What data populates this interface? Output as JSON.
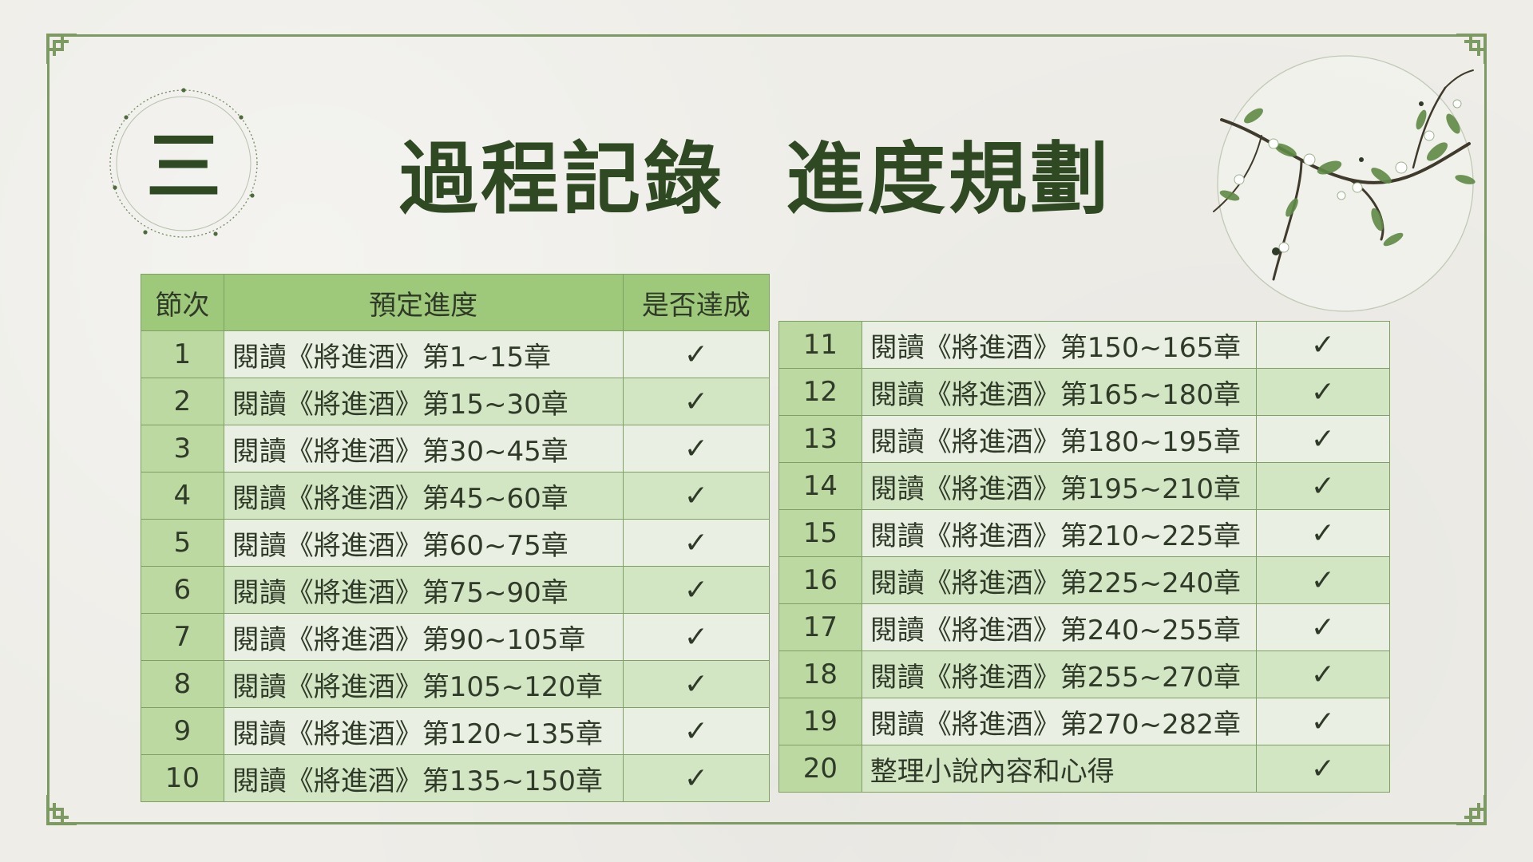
{
  "section_number": "三",
  "title": "過程記錄  進度規劃",
  "colors": {
    "frame": "#7d9a62",
    "title_text": "#2f4a22",
    "header_bg": "#9fc97a",
    "number_column_bg": "#bcd9a2",
    "row_light": "#e9efe3",
    "row_green": "#d3e6c4"
  },
  "table": {
    "headers": {
      "session": "節次",
      "plan": "預定進度",
      "done": "是否達成"
    },
    "left_rows": [
      {
        "num": "1",
        "task": "閱讀《將進酒》第1~15章",
        "done": "✓"
      },
      {
        "num": "2",
        "task": "閱讀《將進酒》第15~30章",
        "done": "✓"
      },
      {
        "num": "3",
        "task": "閱讀《將進酒》第30~45章",
        "done": "✓"
      },
      {
        "num": "4",
        "task": "閱讀《將進酒》第45~60章",
        "done": "✓"
      },
      {
        "num": "5",
        "task": "閱讀《將進酒》第60~75章",
        "done": "✓"
      },
      {
        "num": "6",
        "task": "閱讀《將進酒》第75~90章",
        "done": "✓"
      },
      {
        "num": "7",
        "task": "閱讀《將進酒》第90~105章",
        "done": "✓"
      },
      {
        "num": "8",
        "task": "閱讀《將進酒》第105~120章",
        "done": "✓"
      },
      {
        "num": "9",
        "task": "閱讀《將進酒》第120~135章",
        "done": "✓"
      },
      {
        "num": "10",
        "task": "閱讀《將進酒》第135~150章",
        "done": "✓"
      }
    ],
    "right_rows": [
      {
        "num": "11",
        "task": "閱讀《將進酒》第150~165章",
        "done": "✓"
      },
      {
        "num": "12",
        "task": "閱讀《將進酒》第165~180章",
        "done": "✓"
      },
      {
        "num": "13",
        "task": "閱讀《將進酒》第180~195章",
        "done": "✓"
      },
      {
        "num": "14",
        "task": "閱讀《將進酒》第195~210章",
        "done": "✓"
      },
      {
        "num": "15",
        "task": "閱讀《將進酒》第210~225章",
        "done": "✓"
      },
      {
        "num": "16",
        "task": "閱讀《將進酒》第225~240章",
        "done": "✓"
      },
      {
        "num": "17",
        "task": "閱讀《將進酒》第240~255章",
        "done": "✓"
      },
      {
        "num": "18",
        "task": "閱讀《將進酒》第255~270章",
        "done": "✓"
      },
      {
        "num": "19",
        "task": "閱讀《將進酒》第270~282章",
        "done": "✓"
      },
      {
        "num": "20",
        "task": "整理小說內容和心得",
        "done": "✓"
      }
    ]
  }
}
